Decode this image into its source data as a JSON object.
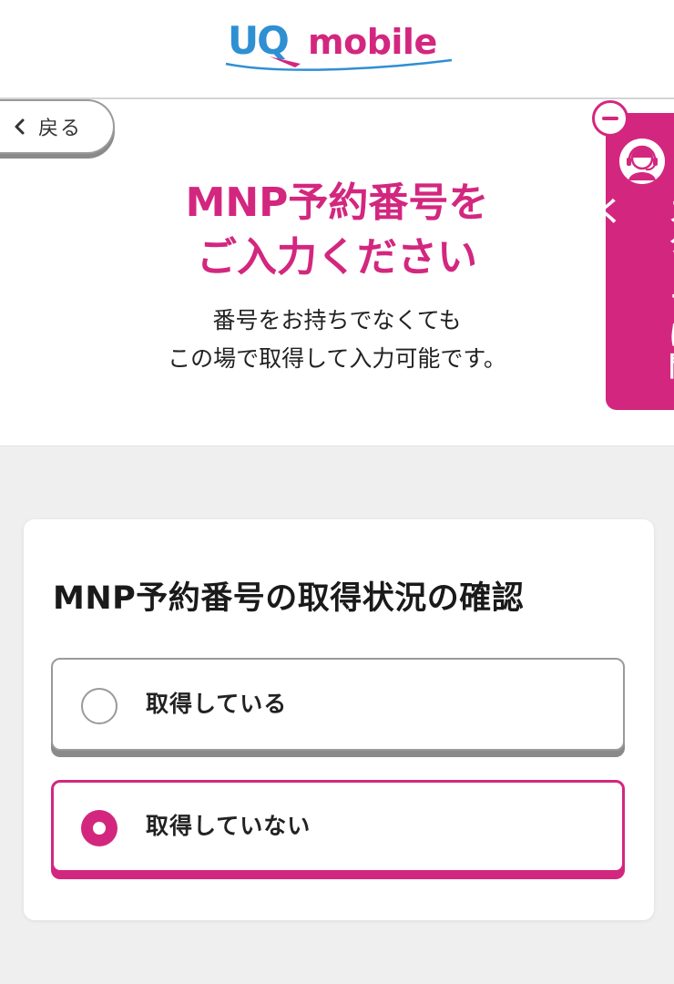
{
  "header": {
    "logo_uq": "UQ",
    "logo_mobile": "mobile",
    "brand_colors": {
      "blue": "#2f8fd3",
      "magenta": "#d3277f"
    }
  },
  "nav": {
    "back_label": "戻る",
    "back_icon": "chevron-left-icon"
  },
  "hero": {
    "title_line1": "MNP予約番号を",
    "title_line2": "ご入力ください",
    "subtitle_line1": "番号をお持ちでなくても",
    "subtitle_line2": "この場で取得して入力可能です。"
  },
  "staff_help": {
    "label": "スタッフに聞く",
    "avatar_icon": "headset-operator-icon",
    "toggle_icon": "minus-icon"
  },
  "form": {
    "title": "MNP予約番号の取得状況の確認",
    "options": [
      {
        "label": "取得している",
        "selected": false
      },
      {
        "label": "取得していない",
        "selected": true
      }
    ]
  }
}
